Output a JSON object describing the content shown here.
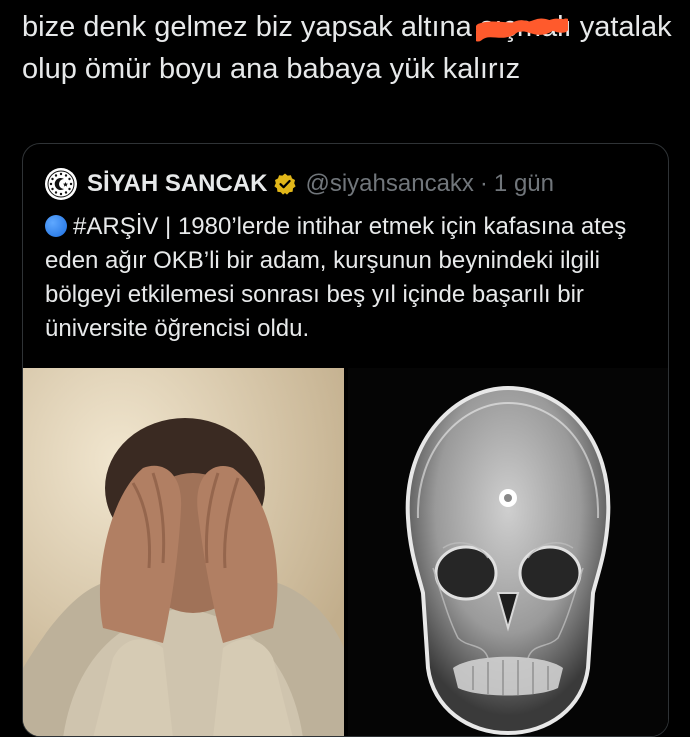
{
  "tweet": {
    "text_part1": "bize denk gelmez biz yapsak altına ",
    "scribbled_word": "sıçmalı",
    "text_part2": " yatalak olup ömür boyu ana babaya yük kalırız",
    "scribble_color": "#ff5a2c"
  },
  "quoted_tweet": {
    "avatar_icon": "republic-emblem-icon",
    "author_name": "SİYAH SANCAK",
    "verified_badge": "gold-verified-icon",
    "handle": "@siyahsancakx",
    "separator": "·",
    "time": "1 gün",
    "text_tag": "#ARŞİV",
    "text_body": " | 1980’lerde intihar etmek için kafasına ateş eden ağır OKB’li bir adam, kurşunun beynindeki ilgili bölgeyi etkilemesi sonrası beş yıl içinde başarılı bir üniversite öğrencisi oldu.",
    "media": [
      {
        "name": "man-holding-head-photo"
      },
      {
        "name": "skull-xray-image"
      }
    ]
  },
  "colors": {
    "background": "#000000",
    "text": "#e7e9ea",
    "muted": "#71767b",
    "border": "#2f3336",
    "verified": "#e2b719"
  }
}
